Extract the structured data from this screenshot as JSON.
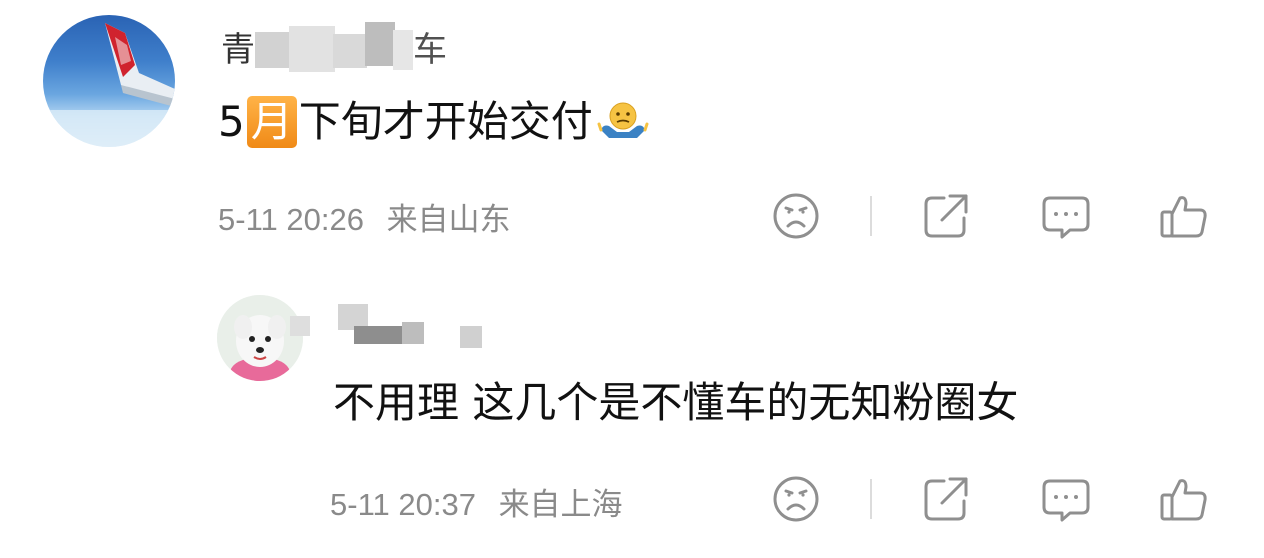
{
  "comment": {
    "username_visible_start": "青",
    "username_visible_end": "车",
    "text_prefix": "5",
    "text_badge": "月",
    "text_suffix": "下旬才开始交付",
    "emoji": "shrug-emoji",
    "timestamp": "5-11 20:26",
    "location": "来自山东"
  },
  "reply": {
    "text": "不用理 这几个是不懂车的无知粉圈女",
    "timestamp": "5-11 20:37",
    "location": "来自上海"
  },
  "colors": {
    "meta_gray": "#8a8a8a",
    "icon_gray": "#8f8f8f",
    "badge_orange": "#f08a17"
  },
  "actions": [
    "sad-face-icon",
    "share-icon",
    "comment-icon",
    "like-icon"
  ]
}
